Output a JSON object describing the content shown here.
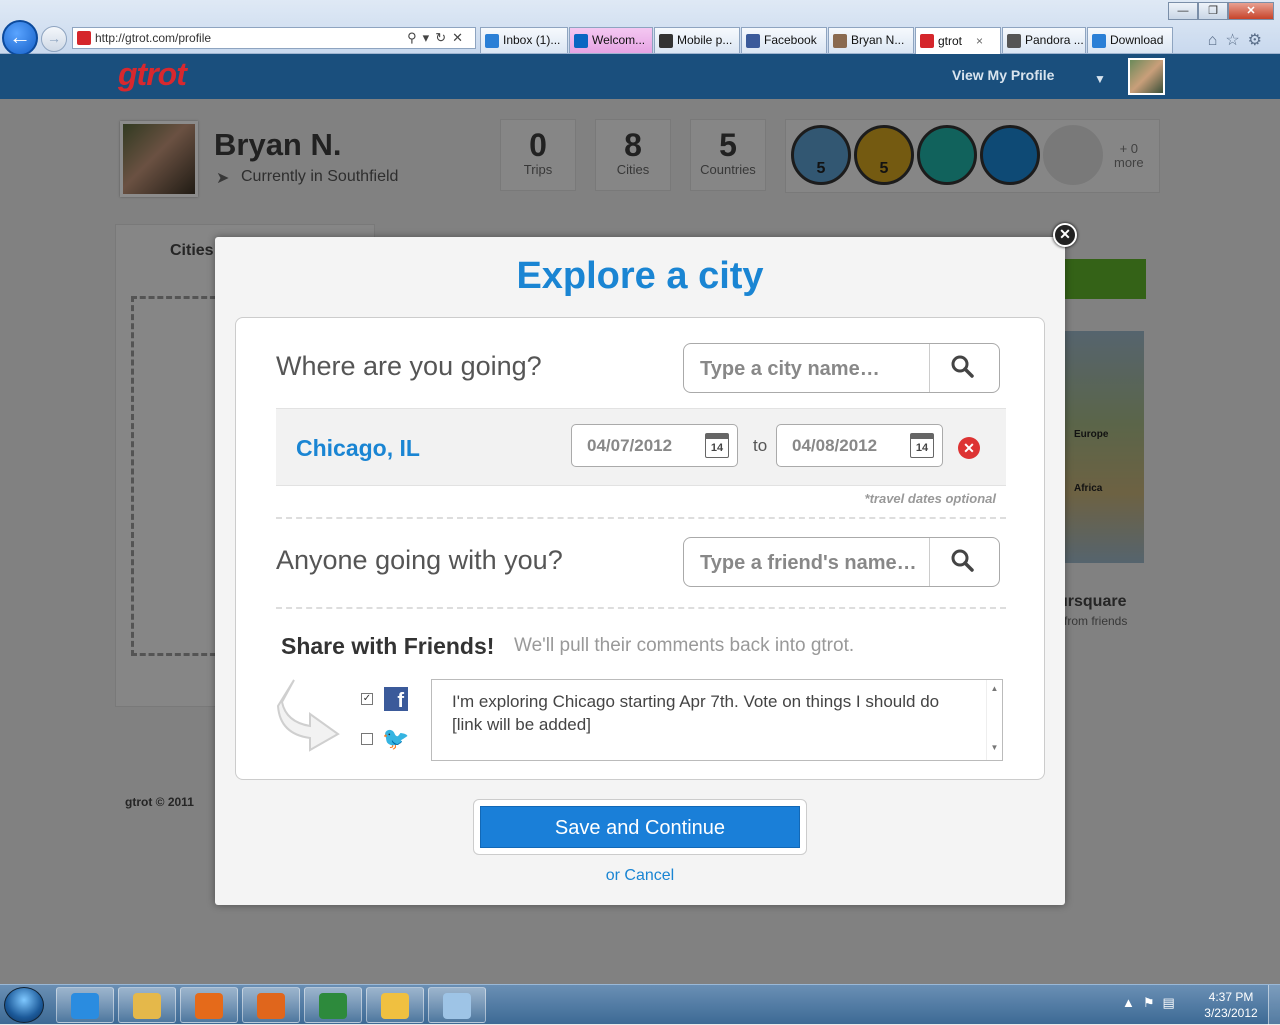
{
  "browser": {
    "url": "http://gtrot.com/profile",
    "tabs": [
      {
        "label": "Inbox (1)...",
        "icon": "ie-icon",
        "color": "#2a7fd6",
        "style": "normal"
      },
      {
        "label": "Welcom...",
        "icon": "linkedin-icon",
        "color": "#0a66c2",
        "style": "pink"
      },
      {
        "label": "Mobile p...",
        "icon": "nytimes-icon",
        "color": "#333333",
        "style": "normal"
      },
      {
        "label": "Facebook",
        "icon": "facebook-icon",
        "color": "#3b5a9a",
        "style": "normal"
      },
      {
        "label": "Bryan N...",
        "icon": "avatar-icon",
        "color": "#8a6a50",
        "style": "normal"
      },
      {
        "label": "gtrot",
        "icon": "gtrot-icon",
        "color": "#d5262b",
        "style": "active"
      },
      {
        "label": "Pandora ...",
        "icon": "pandora-icon",
        "color": "#555555",
        "style": "normal"
      },
      {
        "label": "Download",
        "icon": "ie-icon",
        "color": "#2a7fd6",
        "style": "normal"
      }
    ],
    "tab_close": "×"
  },
  "site": {
    "logo": "gtrot",
    "view_profile": "View My Profile"
  },
  "profile": {
    "name": "Bryan N.",
    "location": "Currently in Southfield",
    "stats": [
      {
        "value": "0",
        "label": "Trips"
      },
      {
        "value": "8",
        "label": "Cities"
      },
      {
        "value": "5",
        "label": "Countries"
      }
    ],
    "badges": [
      {
        "name": "passport-badge",
        "number": "5",
        "color": "#5b9fd0"
      },
      {
        "name": "city-badge",
        "number": "5",
        "color": "#d4a520"
      },
      {
        "name": "americas-badge",
        "number": "",
        "color": "#1fb3a8"
      },
      {
        "name": "europe-badge",
        "number": "",
        "color": "#1a87d6"
      },
      {
        "name": "locked-badge",
        "number": "",
        "color": "#dddddd"
      }
    ],
    "more_count": "+ 0",
    "more_label": "more"
  },
  "background": {
    "cities_tab": "Cities",
    "map_europe": "Europe",
    "map_africa": "Africa",
    "foursquare": "ursquare",
    "from_friends": "from friends",
    "copyright": "gtrot © 2011"
  },
  "modal": {
    "title": "Explore a city",
    "where_label": "Where are you going?",
    "city_placeholder": "Type a city name…",
    "city": "Chicago, IL",
    "date_from": "04/07/2012",
    "date_to": "04/08/2012",
    "date_sep": "to",
    "calendar_day": "14",
    "dates_optional": "*travel dates optional",
    "friends_label": "Anyone going with you?",
    "friend_placeholder": "Type a friend's name…",
    "share_title": "Share with Friends!",
    "share_subtitle": "We'll pull their comments back into gtrot.",
    "facebook_checked": true,
    "twitter_checked": false,
    "share_message": "I'm exploring Chicago starting Apr 7th. Vote on things I should do [link will be added]",
    "save_button": "Save and Continue",
    "cancel_link": "or Cancel"
  },
  "taskbar": {
    "apps": [
      {
        "name": "ie-taskbar",
        "color": "#2a8ce0"
      },
      {
        "name": "explorer-taskbar",
        "color": "#e5b84a"
      },
      {
        "name": "media-player-taskbar",
        "color": "#e56a1a"
      },
      {
        "name": "firefox-taskbar",
        "color": "#e0661c"
      },
      {
        "name": "excel-taskbar",
        "color": "#2d8a3c"
      },
      {
        "name": "outlook-taskbar",
        "color": "#f0c040"
      },
      {
        "name": "paint-taskbar",
        "color": "#9ec4e6"
      }
    ],
    "time": "4:37 PM",
    "date": "3/23/2012"
  }
}
